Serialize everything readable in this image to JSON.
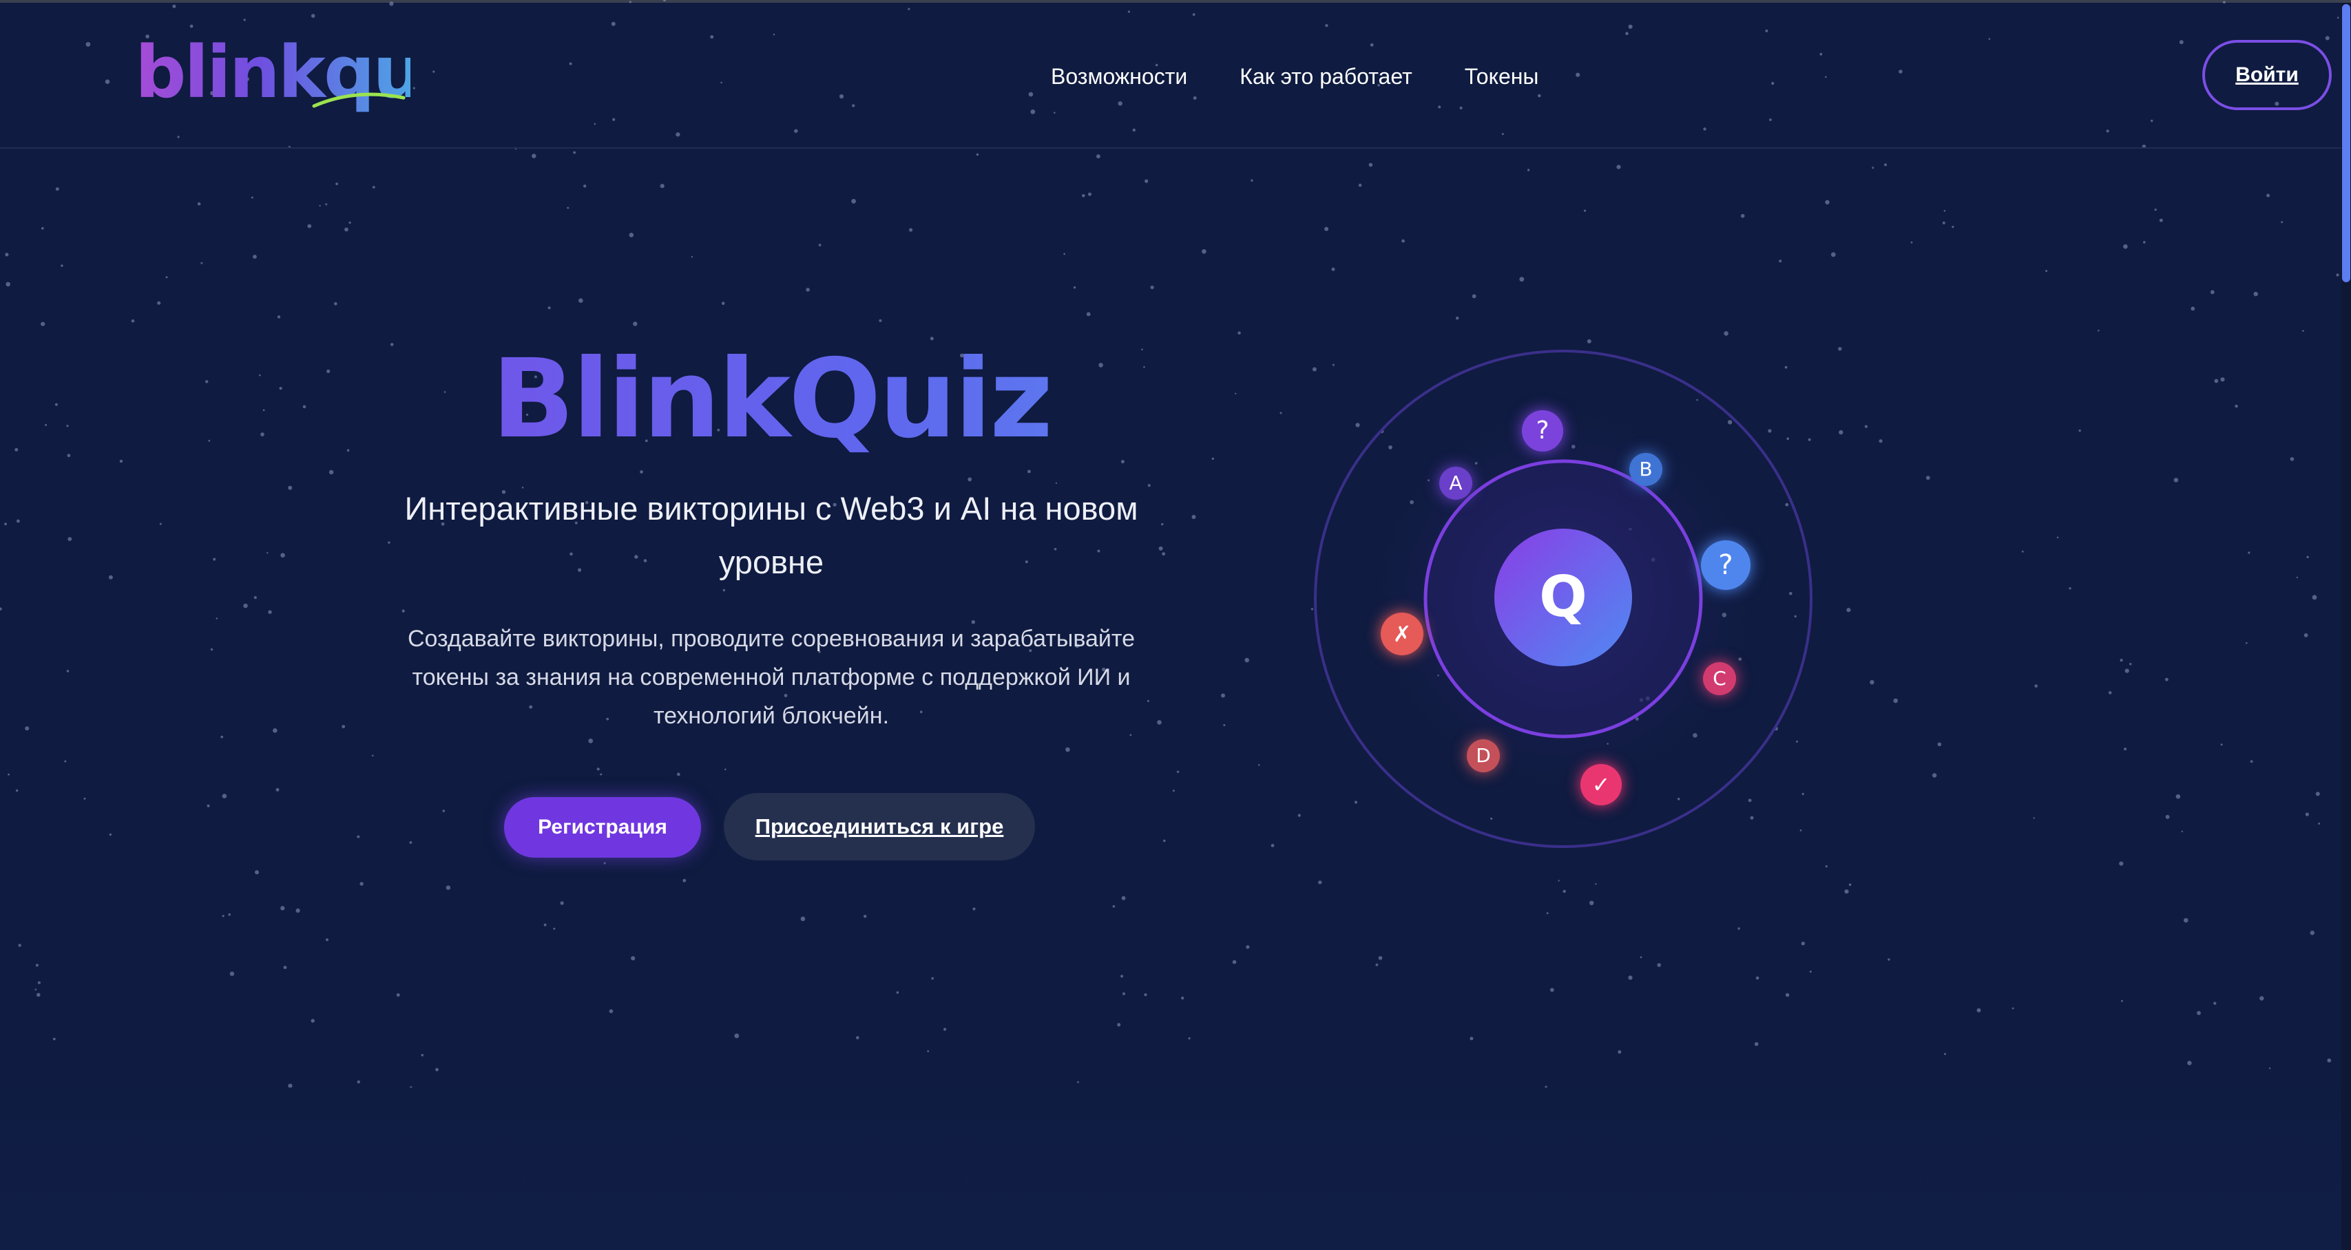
{
  "header": {
    "logo_text": "blinkquiz",
    "nav": [
      "Возможности",
      "Как это работает",
      "Токены"
    ],
    "login_label": "Войти"
  },
  "hero": {
    "title": "BlinkQuiz",
    "subtitle": "Интерактивные викторины с Web3 и AI на новом уровне",
    "description": "Создавайте викторины, проводите соревнования и зарабатывайте токены за знания на современной платформе с поддержкой ИИ и технологий блокчейн.",
    "register_label": "Регистрация",
    "join_label": "Присоединиться к игре"
  },
  "graphic": {
    "center_label": "Q",
    "bubbles": [
      {
        "label": "?",
        "color": "#7b43dc",
        "icon": "question-icon"
      },
      {
        "label": "A",
        "color": "#6a3fc9",
        "icon": "letter-a"
      },
      {
        "label": "B",
        "color": "#3f74d4",
        "icon": "letter-b"
      },
      {
        "label": "?",
        "color": "#4f86ee",
        "icon": "question-icon"
      },
      {
        "label": "✗",
        "color": "#e65a57",
        "icon": "cross-icon"
      },
      {
        "label": "C",
        "color": "#d23b6f",
        "icon": "letter-c"
      },
      {
        "label": "D",
        "color": "#c4505a",
        "icon": "letter-d"
      },
      {
        "label": "✓",
        "color": "#ea3670",
        "icon": "check-icon"
      }
    ]
  },
  "colors": {
    "background": "#0f1b40",
    "accent_purple": "#7037e0",
    "accent_blue": "#5a8cf0",
    "secondary_button": "#252f4e"
  }
}
